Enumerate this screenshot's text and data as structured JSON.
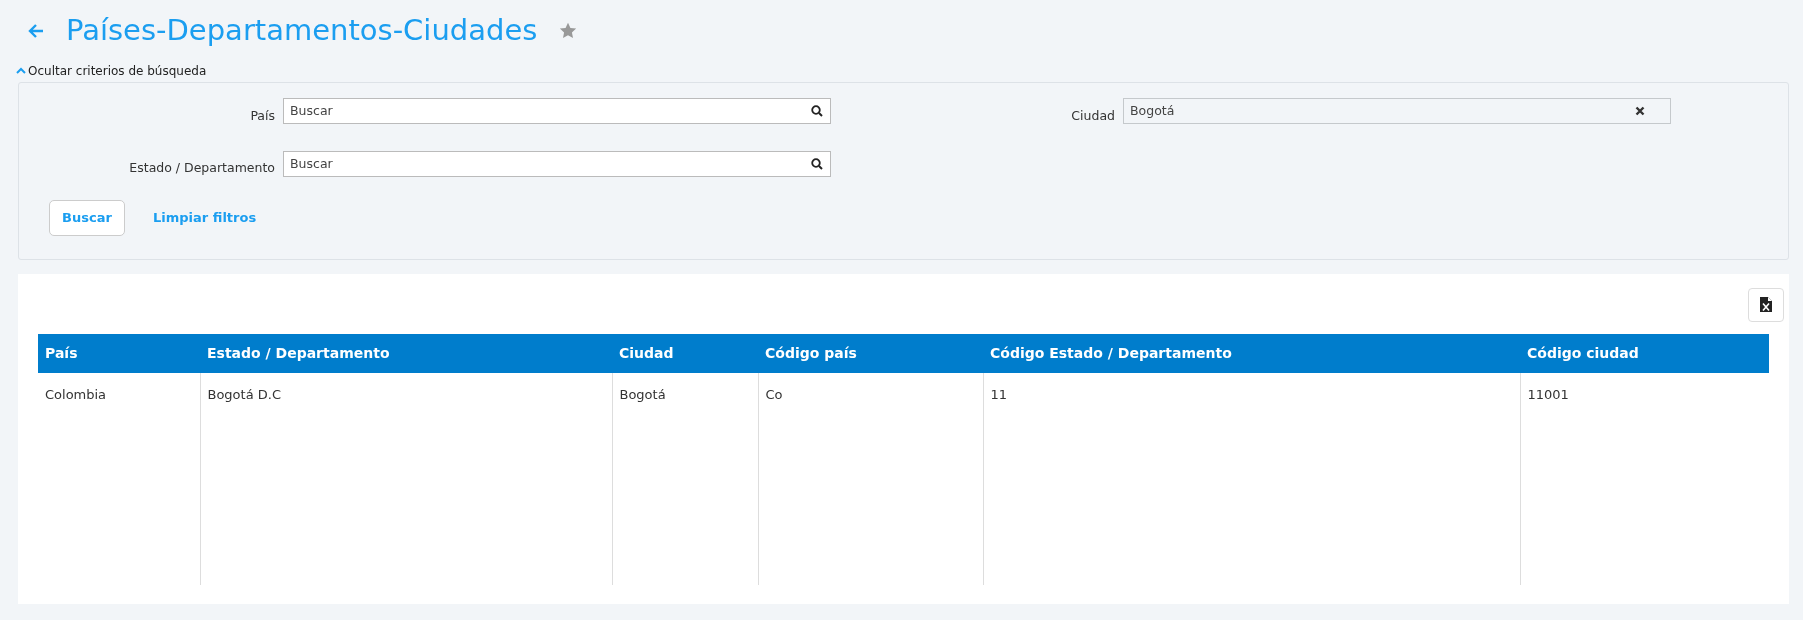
{
  "header": {
    "title": "Países-Departamentos-Ciudades",
    "favorite": false
  },
  "filters_toggle": {
    "label": "Ocultar criterios de búsqueda",
    "expanded": true
  },
  "filters": [
    {
      "label": "País",
      "kind": "search",
      "placeholder": "Buscar"
    },
    {
      "label": "Ciudad",
      "kind": "clearable",
      "value": "Bogotá"
    },
    {
      "label": "Estado / Departamento",
      "kind": "search",
      "placeholder": "Buscar"
    }
  ],
  "actions": {
    "search": "Buscar",
    "clear": "Limpiar filtros"
  },
  "table": {
    "columns": [
      "País",
      "Estado / Departamento",
      "Ciudad",
      "Código país",
      "Código Estado / Departamento",
      "Código ciudad"
    ],
    "rows": [
      [
        "Colombia",
        "Bogotá D.C",
        "Bogotá",
        "Co",
        "11",
        "11001"
      ]
    ]
  }
}
